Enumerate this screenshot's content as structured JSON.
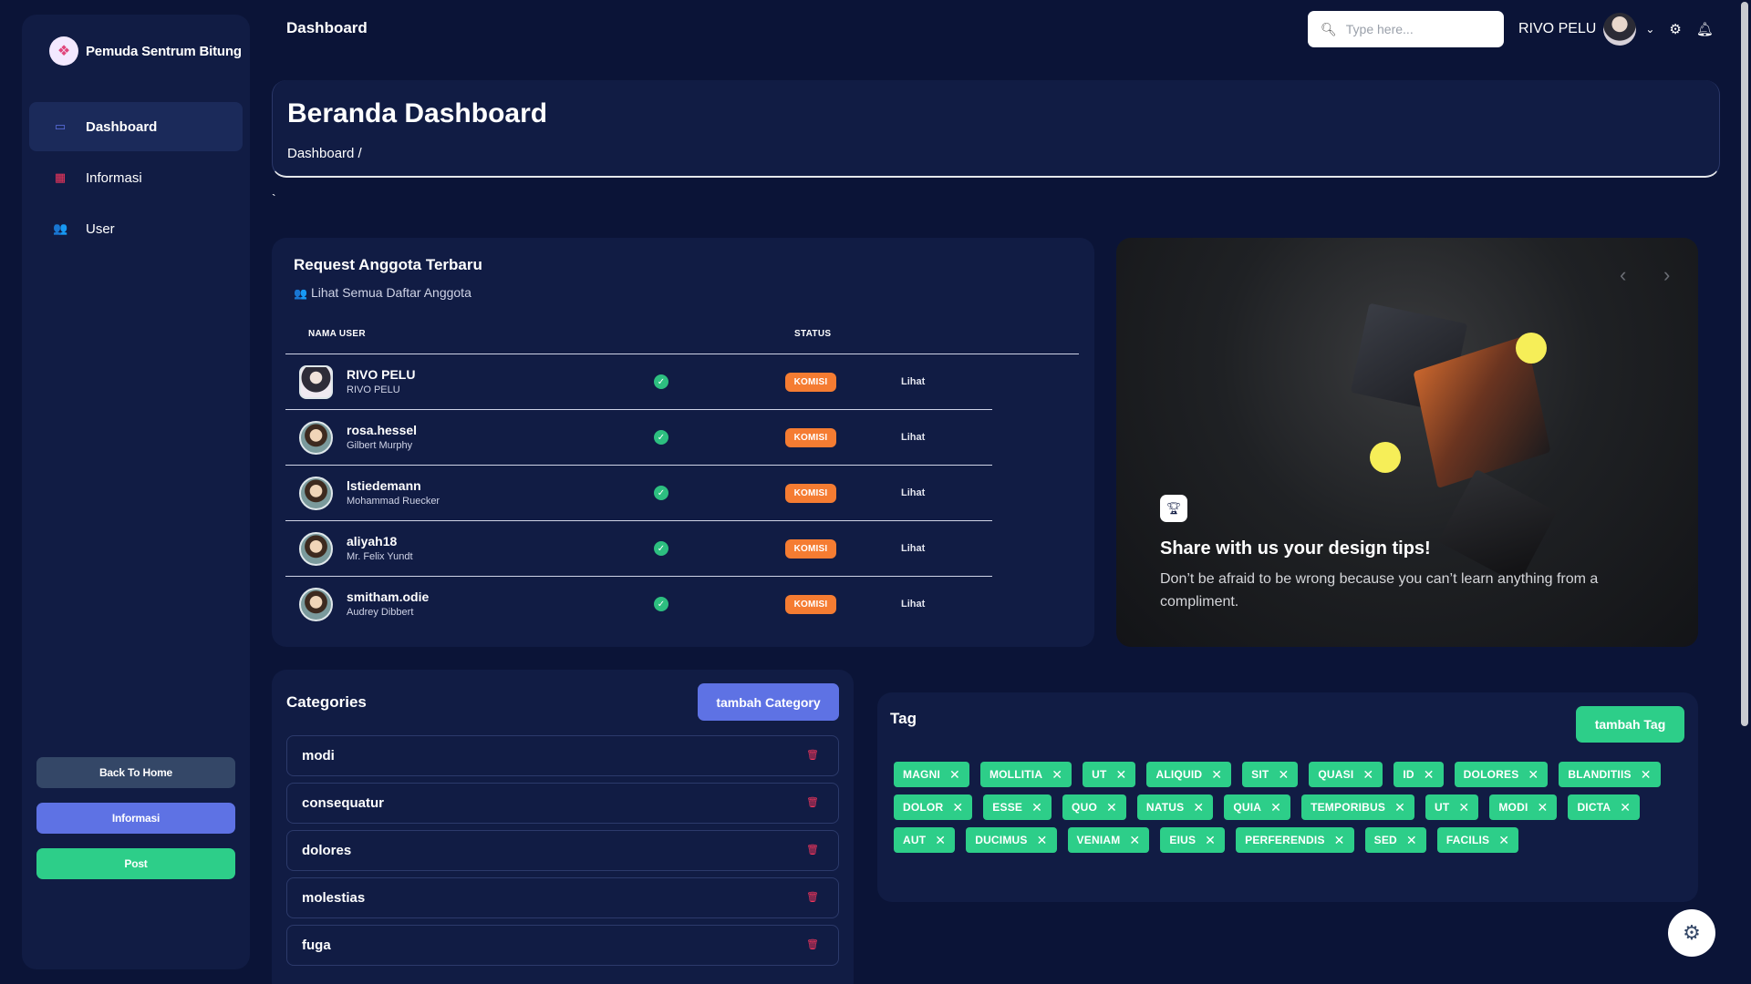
{
  "sidebar": {
    "brand": "Pemuda Sentrum Bitung",
    "nav": [
      {
        "label": "Dashboard",
        "icon": "monitor-icon"
      },
      {
        "label": "Informasi",
        "icon": "calendar-icon"
      },
      {
        "label": "User",
        "icon": "users-icon"
      }
    ],
    "buttons": {
      "back_home": "Back To Home",
      "informasi": "Informasi",
      "post": "Post"
    }
  },
  "topbar": {
    "title": "Dashboard",
    "search_placeholder": "Type here...",
    "user_name": "RIVO PELU"
  },
  "header": {
    "title": "Beranda Dashboard",
    "breadcrumb": "Dashboard  /",
    "stray": "`"
  },
  "requests": {
    "title": "Request Anggota Terbaru",
    "subtitle": "Lihat Semua Daftar Anggota",
    "col_name": "NAMA USER",
    "col_status": "STATUS",
    "rows": [
      {
        "username": "RIVO PELU",
        "fullname": "RIVO PELU",
        "badge": "KOMISI",
        "action": "Lihat"
      },
      {
        "username": "rosa.hessel",
        "fullname": "Gilbert Murphy",
        "badge": "KOMISI",
        "action": "Lihat"
      },
      {
        "username": "lstiedemann",
        "fullname": "Mohammad Ruecker",
        "badge": "KOMISI",
        "action": "Lihat"
      },
      {
        "username": "aliyah18",
        "fullname": "Mr. Felix Yundt",
        "badge": "KOMISI",
        "action": "Lihat"
      },
      {
        "username": "smitham.odie",
        "fullname": "Audrey Dibbert",
        "badge": "KOMISI",
        "action": "Lihat"
      }
    ]
  },
  "promo": {
    "title": "Share with us your design tips!",
    "text": "Don’t be afraid to be wrong because you can’t learn anything from a compliment."
  },
  "categories": {
    "title": "Categories",
    "add_button": "tambah Category",
    "items": [
      "modi",
      "consequatur",
      "dolores",
      "molestias",
      "fuga"
    ]
  },
  "tags": {
    "title": "Tag",
    "add_button": "tambah Tag",
    "items": [
      "MAGNI",
      "MOLLITIA",
      "UT",
      "ALIQUID",
      "SIT",
      "QUASI",
      "ID",
      "DOLORES",
      "BLANDITIIS",
      "DOLOR",
      "ESSE",
      "QUO",
      "NATUS",
      "QUIA",
      "TEMPORIBUS",
      "UT",
      "MODI",
      "DICTA",
      "AUT",
      "DUCIMUS",
      "VENIAM",
      "EIUS",
      "PERFERENDIS",
      "SED",
      "FACILIS"
    ]
  },
  "colors": {
    "background": "#0b1437",
    "card": "#111c44",
    "primary": "#5e72e4",
    "success": "#2dce89",
    "warning": "#f57c32",
    "danger": "#f5365c"
  }
}
